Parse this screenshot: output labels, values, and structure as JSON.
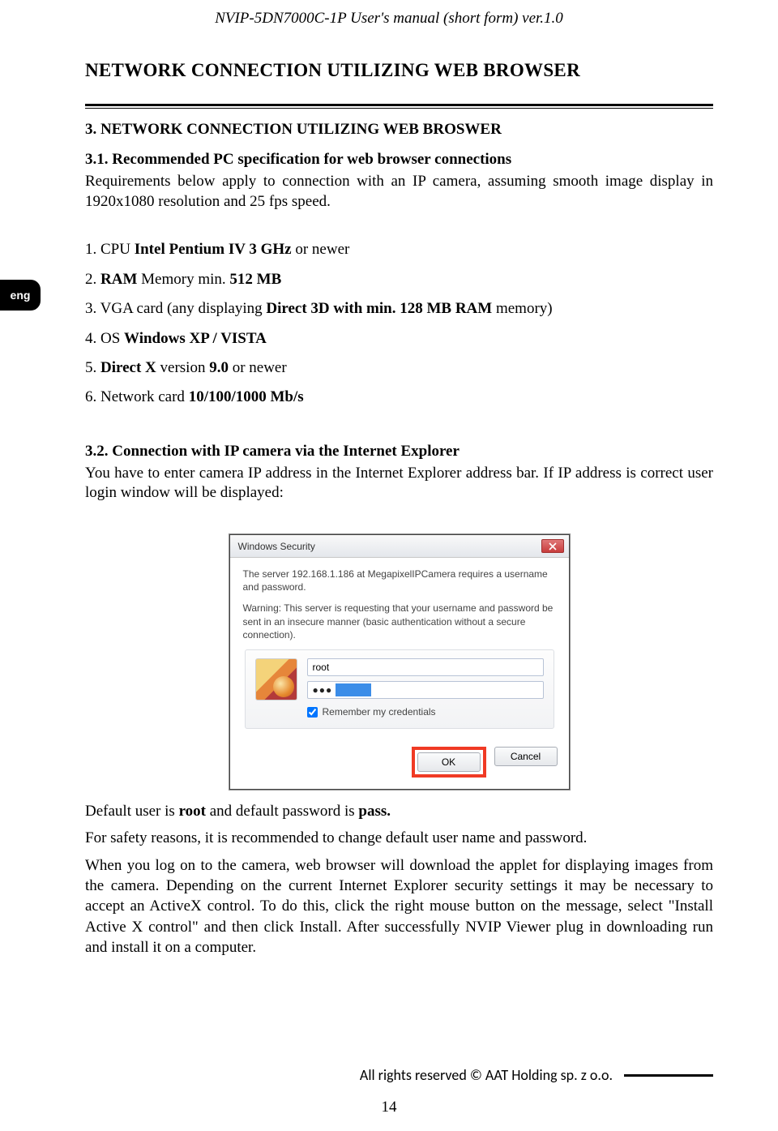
{
  "header": {
    "doc_title": "NVIP-5DN7000C-1P  User's manual (short form) ver.1.0"
  },
  "lang_tab": "eng",
  "page_heading": "NETWORK CONNECTION UTILIZING WEB BROWSER",
  "section3": {
    "title": "3. NETWORK CONNECTION UTILIZING WEB BROSWER",
    "s31_title": "3.1. Recommended PC specification for web browser connections",
    "s31_body": "Requirements below apply to connection with an IP camera, assuming smooth image display in 1920x1080 resolution and 25 fps speed.",
    "spec1_pre": "1. CPU ",
    "spec1_bold": "Intel Pentium IV 3 GHz",
    "spec1_post": " or newer",
    "spec2_pre": "2. ",
    "spec2_bold1": "RAM",
    "spec2_mid": " Memory min. ",
    "spec2_bold2": "512 MB",
    "spec3_pre": "3. VGA card (any displaying ",
    "spec3_bold": "Direct 3D with min. 128 MB RAM",
    "spec3_post": " memory)",
    "spec4_pre": "4. OS ",
    "spec4_bold": "Windows XP / VISTA",
    "spec5_pre": "5. ",
    "spec5_bold1": "Direct X",
    "spec5_mid": " version ",
    "spec5_bold2": "9.0",
    "spec5_post": " or newer",
    "spec6_pre": "6. Network card ",
    "spec6_bold": "10/100/1000 Mb/s"
  },
  "section32": {
    "title": "3.2. Connection with IP camera via the Internet Explorer",
    "body": "You have to enter camera IP address in the Internet Explorer address bar. If IP address is correct user login window will be displayed:"
  },
  "dialog": {
    "title": "Windows Security",
    "line1": "The server 192.168.1.186 at MegapixelIPCamera requires a username and password.",
    "line2": "Warning: This server is requesting that your username and password be sent in an insecure manner (basic authentication without a secure connection).",
    "username_value": "root",
    "password_masked": "●●●",
    "password_selected": "●●●●●",
    "remember_label": "Remember my credentials",
    "remember_checked": true,
    "ok_label": "OK",
    "cancel_label": "Cancel"
  },
  "after_dialog": {
    "p1_pre": "Default user is ",
    "p1_b1": "root",
    "p1_mid": " and default password is ",
    "p1_b2": "pass.",
    "p2": "For safety reasons, it is recommended to change default user name and password.",
    "p3": "When you log on to the camera, web browser will download the applet for displaying images from the camera. Depending on the current Internet Explorer security settings it may be necessary to accept an ActiveX control. To do this, click the right mouse button on the message, select \"Install Active X control\" and then click Install. After successfully NVIP Viewer plug in downloading run and install it on a computer."
  },
  "footer": {
    "text": "All rights reserved © AAT Holding sp. z o.o.",
    "page": "14"
  }
}
